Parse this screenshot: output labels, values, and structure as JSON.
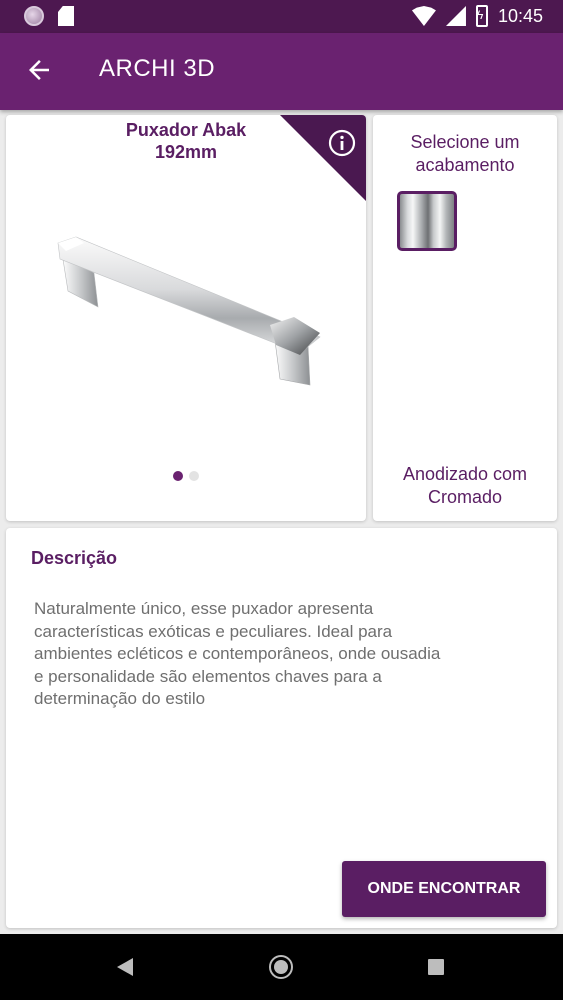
{
  "status_bar": {
    "time": "10:45",
    "icons": [
      "media-dot-icon",
      "sd-card-icon",
      "wifi-icon",
      "signal-icon",
      "battery-charging-icon"
    ]
  },
  "app_bar": {
    "title": "ARCHI 3D",
    "back_icon": "arrow-left-icon"
  },
  "product": {
    "title_line1": "Puxador Abak",
    "title_line2": "192mm",
    "info_icon": "info-icon",
    "pager_total": 2,
    "pager_active": 1
  },
  "finish": {
    "heading_line1": "Selecione um",
    "heading_line2": "acabamento",
    "selected_line1": "Anodizado com",
    "selected_line2": "Cromado"
  },
  "description": {
    "heading": "Descrição",
    "lines": [
      "Naturalmente único, esse puxador apresenta",
      "características exóticas e peculiares. Ideal para",
      "ambientes ecléticos e contemporâneos, onde ousadia",
      "e personalidade são elementos chaves para a",
      "determinação do estilo"
    ],
    "button_label": "ONDE ENCONTRAR"
  },
  "nav_bar": {
    "icons": [
      "nav-back-icon",
      "nav-home-icon",
      "nav-recents-icon"
    ]
  },
  "colors": {
    "primary": "#6a2270",
    "primary_dark": "#4d1850",
    "accent_text": "#5a1e63"
  }
}
